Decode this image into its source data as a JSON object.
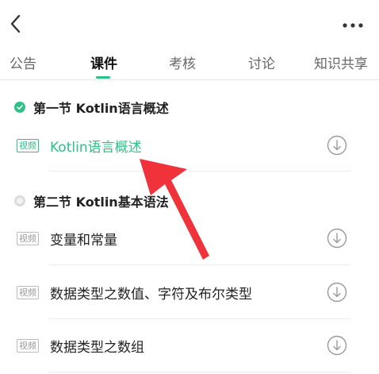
{
  "tabs": [
    {
      "label": "公告"
    },
    {
      "label": "课件"
    },
    {
      "label": "考核"
    },
    {
      "label": "讨论"
    },
    {
      "label": "知识共享"
    }
  ],
  "active_tab": "课件",
  "sections": [
    {
      "title": "第一节 Kotlin语言概述"
    },
    {
      "title": "第二节 Kotlin基本语法"
    }
  ],
  "items": [
    {
      "badge": "视频",
      "title": "Kotlin语言概述"
    },
    {
      "badge": "视频",
      "title": "变量和常量"
    },
    {
      "badge": "视频",
      "title": "数据类型之数值、字符及布尔类型"
    },
    {
      "badge": "视频",
      "title": "数据类型之数组"
    }
  ],
  "colors": {
    "accent": "#2fc08a",
    "annotation_arrow": "#f0323a"
  },
  "icons": [
    "back-arrow-icon",
    "more-dots-icon",
    "check-circle-icon",
    "download-icon"
  ]
}
